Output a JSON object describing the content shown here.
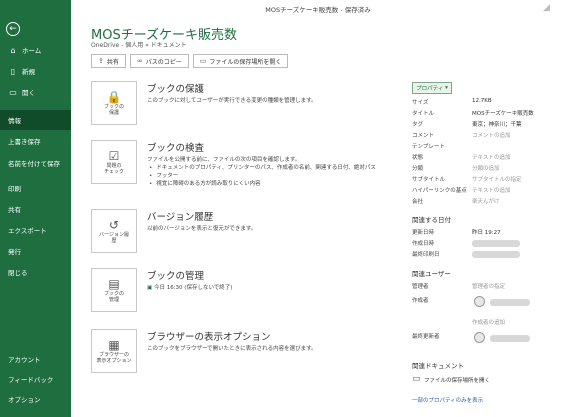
{
  "window": {
    "title": "MOSチーズケーキ販売数 - 保存済み"
  },
  "sidebar": {
    "items": [
      {
        "label": "ホーム",
        "icon": "home-icon"
      },
      {
        "label": "新規",
        "icon": "new-file-icon"
      },
      {
        "label": "開く",
        "icon": "folder-open-icon"
      },
      {
        "label": "情報"
      },
      {
        "label": "上書き保存"
      },
      {
        "label": "名前を付けて保存"
      },
      {
        "label": "印刷"
      },
      {
        "label": "共有"
      },
      {
        "label": "エクスポート"
      },
      {
        "label": "発行"
      },
      {
        "label": "閉じる"
      },
      {
        "label": "アカウント"
      },
      {
        "label": "フィードバック"
      },
      {
        "label": "オプション"
      }
    ]
  },
  "doc": {
    "title": "MOSチーズケーキ販売数",
    "path": "OneDrive - 個人用 » ドキュメント"
  },
  "toolbar": {
    "share": "共有",
    "copy_path": "パスのコピー",
    "open_location": "ファイルの保存場所を開く"
  },
  "sections": [
    {
      "btn": "ブックの\n保護",
      "head": "ブックの保護",
      "desc": "このブックに対してユーザーが実行できる変更の種類を管理します。"
    },
    {
      "btn": "問題の\nチェック",
      "head": "ブックの検査",
      "desc": "ファイルを公開する前に、ファイルの次の項目を確認します。",
      "bullets": [
        "ドキュメントのプロパティ、プリンターのパス、作成者の名前、関連する日付、絶対パス",
        "フッター",
        "視覚に障碍のある方が読み取りにくい内容"
      ]
    },
    {
      "btn": "バージョン履\n歴",
      "head": "バージョン履歴",
      "desc": "以前のバージョンを表示と復元ができます。"
    },
    {
      "btn": "ブックの\n管理",
      "head": "ブックの管理",
      "desc": "今日 16:30 (保存しないで終了)"
    },
    {
      "btn": "ブラウザーの\n表示オプション",
      "head": "ブラウザーの表示オプション",
      "desc": "このブックをブラウザーで開いたときに表示される内容を選びます。"
    }
  ],
  "properties": {
    "button": "プロパティ",
    "rows": [
      {
        "k": "サイズ",
        "v": "12.7KB"
      },
      {
        "k": "タイトル",
        "v": "MOSチーズケーキ販売数"
      },
      {
        "k": "タグ",
        "v": "東京；神奈川；千葉"
      },
      {
        "k": "コメント",
        "v": "コメントの追加",
        "ph": true
      },
      {
        "k": "テンプレート",
        "v": ""
      },
      {
        "k": "状態",
        "v": "テキストの追加",
        "ph": true
      },
      {
        "k": "分類",
        "v": "分類の追加",
        "ph": true
      },
      {
        "k": "サブタイトル",
        "v": "サブタイトルの指定",
        "ph": true
      },
      {
        "k": "ハイパーリンクの基点",
        "v": "テキストの追加",
        "ph": true
      },
      {
        "k": "会社",
        "v": "楽天んがけ",
        "ph": true
      }
    ],
    "dates_head": "関連する日付",
    "dates": [
      {
        "k": "更新日時",
        "v": "昨日 19:27"
      },
      {
        "k": "作成日時",
        "v": ""
      },
      {
        "k": "最終印刷日",
        "v": ""
      }
    ],
    "users_head": "関連ユーザー",
    "users": [
      {
        "k": "管理者",
        "v": "管理者の指定"
      },
      {
        "k": "作成者",
        "v": ""
      },
      {
        "k": "",
        "v": "作成者の追加"
      },
      {
        "k": "最終更新者",
        "v": ""
      }
    ],
    "docs_head": "関連ドキュメント",
    "open_location": "ファイルの保存場所を開く",
    "show_all": "一部のプロパティのみを表示"
  }
}
